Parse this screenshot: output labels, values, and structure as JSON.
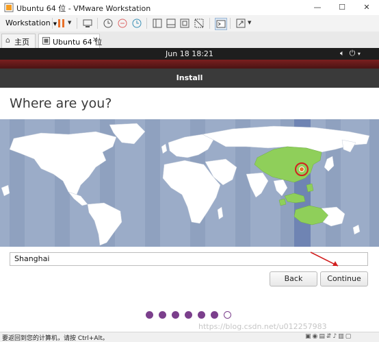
{
  "window": {
    "title": "Ubuntu 64 位 - VMware Workstation",
    "minimize": "—",
    "maximize": "☐",
    "close": "✕"
  },
  "toolbar": {
    "menu_label": "Workstation",
    "icons": [
      "pause-icon",
      "send-ctrl-alt-del-icon",
      "snapshot-icon",
      "revert-snapshot-icon",
      "snapshot-manager-icon",
      "library-icon",
      "thumbnail-icon",
      "fit-window-icon",
      "unity-icon",
      "console-icon",
      "fullscreen-icon"
    ]
  },
  "tabs": [
    {
      "label": "主页",
      "icon": "home-icon"
    },
    {
      "label": "Ubuntu 64 位",
      "icon": "vm-icon"
    }
  ],
  "ubuntu": {
    "clock": "Jun 18  18:21",
    "install_header": "Install",
    "page_title": "Where are you?",
    "timezone_value": "Shanghai",
    "back_label": "Back",
    "continue_label": "Continue",
    "progress": {
      "total": 7,
      "completed": 6
    }
  },
  "status": {
    "text": "要返回到您的计算机，请按 Ctrl+Alt。"
  },
  "watermark": "https://blog.csdn.net/u012257983",
  "colors": {
    "ubuntu_accent": "#7b3f8c",
    "selected_timezone": "#8fcf5a",
    "map_ocean": "#9bacc8",
    "topbar": "#1e1e1e"
  }
}
